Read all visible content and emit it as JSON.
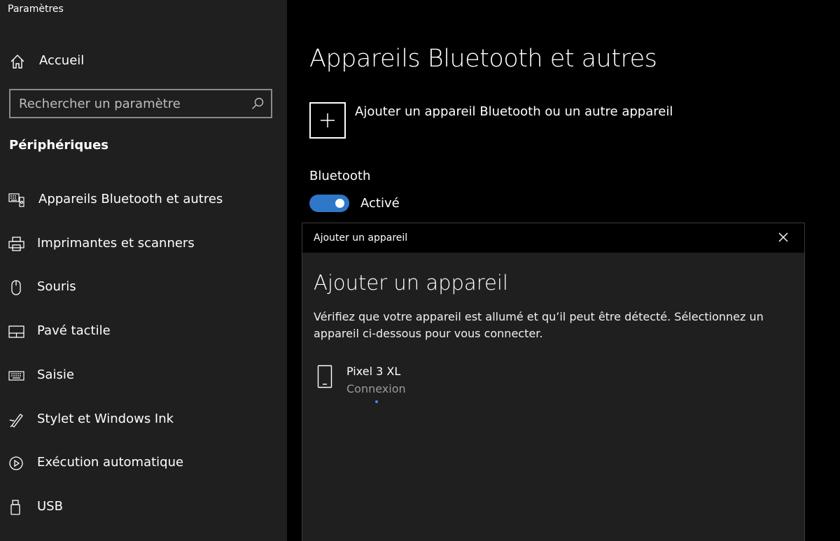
{
  "app": {
    "title": "Paramètres"
  },
  "sidebar": {
    "home_label": "Accueil",
    "search_placeholder": "Rechercher un paramètre",
    "section_title": "Périphériques",
    "items": [
      {
        "label": "Appareils Bluetooth et autres",
        "icon": "bluetooth-devices-icon"
      },
      {
        "label": "Imprimantes et scanners",
        "icon": "printer-icon"
      },
      {
        "label": "Souris",
        "icon": "mouse-icon"
      },
      {
        "label": "Pavé tactile",
        "icon": "touchpad-icon"
      },
      {
        "label": "Saisie",
        "icon": "keyboard-icon"
      },
      {
        "label": "Stylet et Windows Ink",
        "icon": "pen-icon"
      },
      {
        "label": "Exécution automatique",
        "icon": "autoplay-icon"
      },
      {
        "label": "USB",
        "icon": "usb-icon"
      }
    ]
  },
  "main": {
    "title": "Appareils Bluetooth et autres",
    "add_device_label": "Ajouter un appareil Bluetooth ou un autre appareil",
    "bluetooth_label": "Bluetooth",
    "bluetooth_state": "Activé",
    "bluetooth_on": true
  },
  "dialog": {
    "window_title": "Ajouter un appareil",
    "heading": "Ajouter un appareil",
    "description": "Vérifiez que votre appareil est allumé et qu’il peut être détecté. Sélectionnez un appareil ci-dessous pour vous connecter.",
    "device": {
      "name": "Pixel 3 XL",
      "status": "Connexion"
    }
  },
  "colors": {
    "accent": "#2f77c9",
    "sidebar_bg": "#1f1f1f",
    "main_bg": "#000000",
    "dialog_bg": "#1f1f1f"
  }
}
